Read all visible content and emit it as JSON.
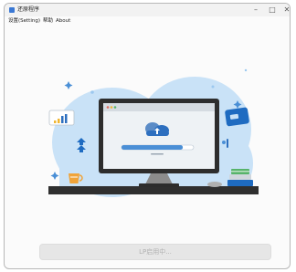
{
  "window": {
    "title": "还原程序",
    "minimize_glyph": "–",
    "maximize_glyph": "□",
    "close_glyph": "✕"
  },
  "menu": {
    "items": [
      "设置(Setting)",
      "帮助",
      "About"
    ]
  },
  "status": {
    "button_label": "LP启用中..."
  },
  "colors": {
    "cloud": "#c9e2f7",
    "monitor_frame": "#2d2d2d",
    "accent": "#4a8fd6",
    "desk": "#2f2f2f"
  },
  "illustration": {
    "icons": [
      "cloud-icon",
      "monitor-icon",
      "bar-chart-icon",
      "credit-card-icon",
      "upload-arrows-icon",
      "coffee-cup-icon",
      "books-icon",
      "sparkle-icon"
    ],
    "progress": 0.85
  }
}
